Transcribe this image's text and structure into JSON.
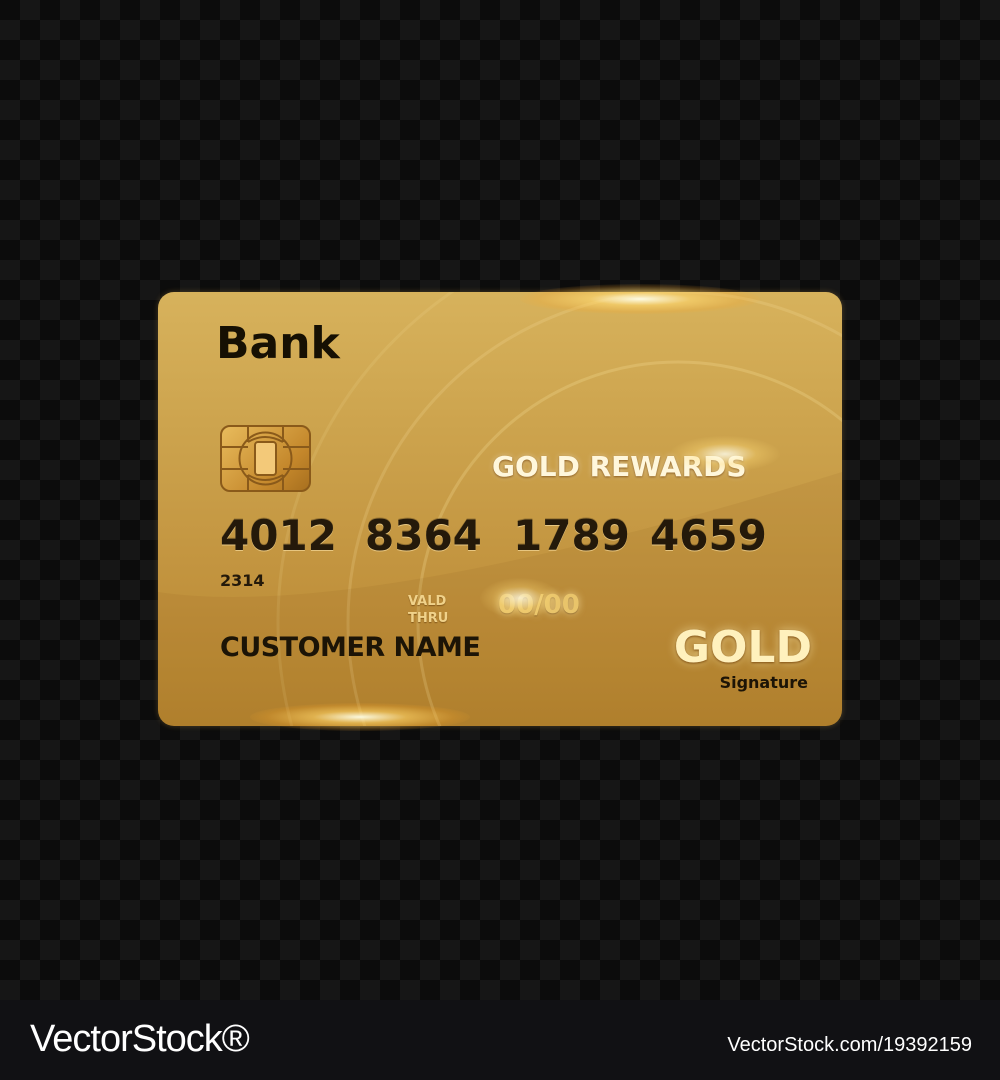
{
  "card": {
    "bank_name": "Bank",
    "rewards_label": "GOLD REWARDS",
    "number_groups": [
      "4012",
      "8364",
      "1789",
      "4659"
    ],
    "small_code": "2314",
    "valid_label_line1": "VALD",
    "valid_label_line2": "THRU",
    "valid_value": "00/00",
    "customer_name": "CUSTOMER NAME",
    "tier_logo": "GOLD",
    "tier_sub": "Signature"
  },
  "watermark": {
    "logo": "VectorStock®",
    "image_id": "VectorStock.com/19392159"
  },
  "colors": {
    "card_gold": "#cda44e",
    "text_dark": "#1c1406",
    "background": "#0c0c0c"
  },
  "icons": [
    "chip-icon"
  ]
}
